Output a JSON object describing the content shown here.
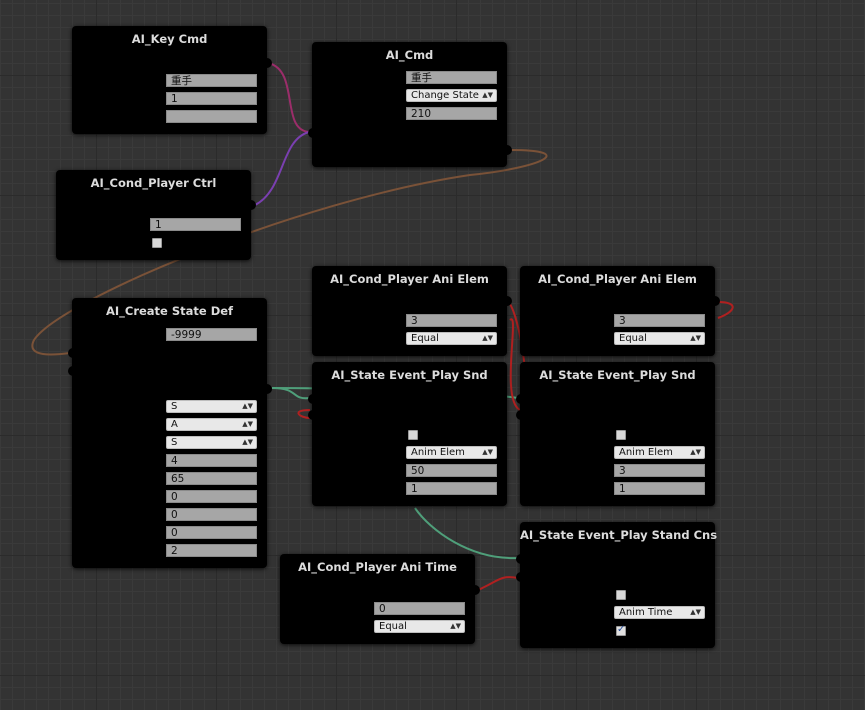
{
  "nodes": {
    "key_cmd": {
      "title": "AI_Key Cmd",
      "field1": "重手",
      "field2": "1",
      "field3": ""
    },
    "cmd": {
      "title": "AI_Cmd",
      "field1": "重手",
      "select1": "Change State",
      "field2": "210"
    },
    "player_ctrl": {
      "title": "AI_Cond_Player Ctrl",
      "field1": "1"
    },
    "create_state": {
      "title": "AI_Create State Def",
      "field_top": "-9999",
      "selects": [
        "S",
        "A",
        "S"
      ],
      "fields": [
        "4",
        "65",
        "0",
        "0",
        "0",
        "2"
      ]
    },
    "ani_elem_1": {
      "title": "AI_Cond_Player Ani Elem",
      "field1": "3",
      "select1": "Equal"
    },
    "ani_elem_2": {
      "title": "AI_Cond_Player Ani Elem",
      "field1": "3",
      "select1": "Equal"
    },
    "play_snd_1": {
      "title": "AI_State Event_Play Snd",
      "select1": "Anim Elem",
      "field1": "50",
      "field2": "1"
    },
    "play_snd_2": {
      "title": "AI_State Event_Play Snd",
      "select1": "Anim Elem",
      "field1": "3",
      "field2": "1"
    },
    "ani_time": {
      "title": "AI_Cond_Player Ani Time",
      "field1": "0",
      "select1": "Equal"
    },
    "stand_cns": {
      "title": "AI_State Event_Play Stand Cns",
      "select1": "Anim Time"
    }
  },
  "colors": {
    "background": "#333333",
    "node": "#000000",
    "wire_pink": "#9b2d6a",
    "wire_purple": "#7a3fb0",
    "wire_orange": "#7a5238",
    "wire_green": "#4f9f7a",
    "wire_red": "#b02020"
  },
  "icons": {
    "dropdown": "caret-updown-icon",
    "checkbox_checked": "checkmark-icon"
  }
}
